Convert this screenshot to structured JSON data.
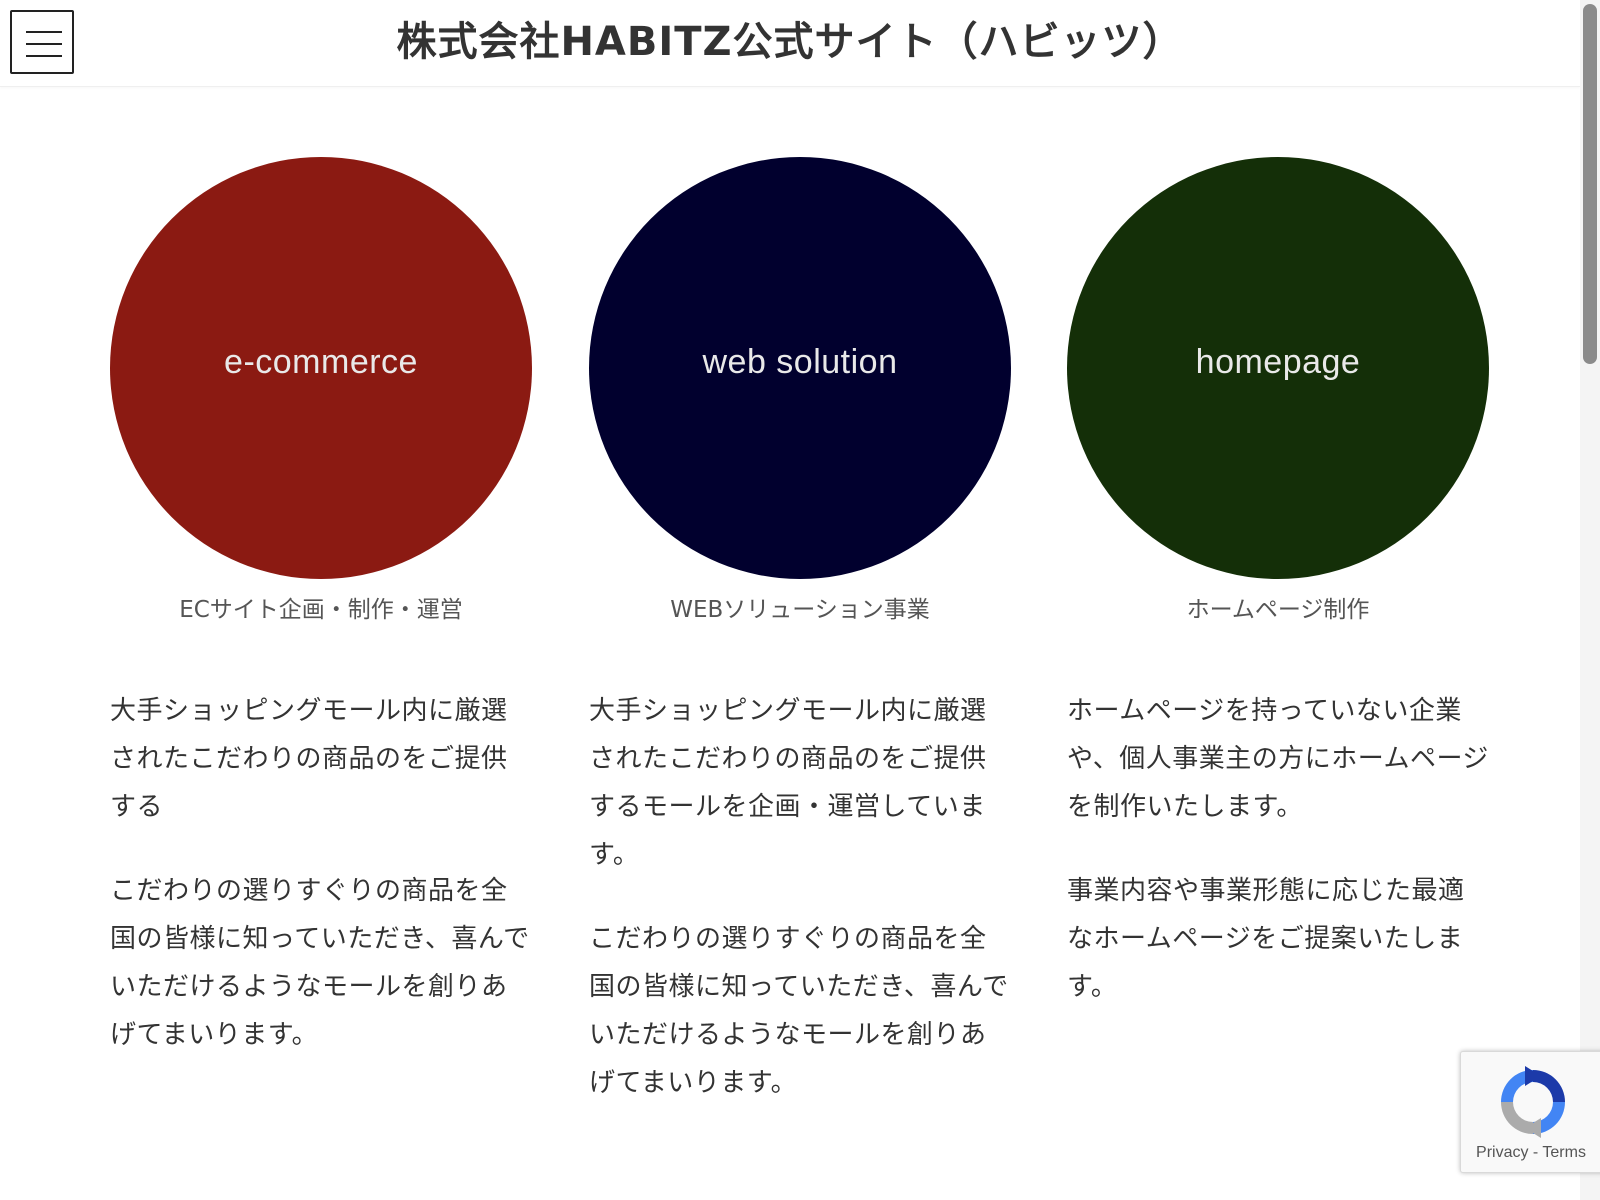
{
  "header": {
    "title": "株式会社HABITZ公式サイト（ハビッツ）",
    "menu_icon": "hamburger-menu-icon"
  },
  "services": [
    {
      "circle_label": "e-commerce",
      "circle_color": "#8b1a12",
      "caption": "ECサイト企画・制作・運営",
      "paragraphs": [
        "大手ショッピングモール内に厳選されたこだわりの商品のをご提供する",
        "こだわりの選りすぐりの商品を全国の皆様に知っていただき、喜んでいただけるようなモールを創りあげてまいります。"
      ]
    },
    {
      "circle_label": "web solution",
      "circle_color": "#01002e",
      "caption": "WEBソリューション事業",
      "paragraphs": [
        "大手ショッピングモール内に厳選されたこだわりの商品のをご提供するモールを企画・運営しています。",
        "こだわりの選りすぐりの商品を全国の皆様に知っていただき、喜んでいただけるようなモールを創りあげてまいります。"
      ]
    },
    {
      "circle_label": "homepage",
      "circle_color": "#142f08",
      "caption": "ホームページ制作",
      "paragraphs": [
        "ホームページを持っていない企業や、個人事業主の方にホームページを制作いたします。",
        "事業内容や事業形態に応じた最適なホームページをご提案いたします。"
      ]
    }
  ],
  "recaptcha": {
    "privacy": "Privacy",
    "separator": " - ",
    "terms": "Terms",
    "logo_icon": "recaptcha-logo-icon"
  }
}
